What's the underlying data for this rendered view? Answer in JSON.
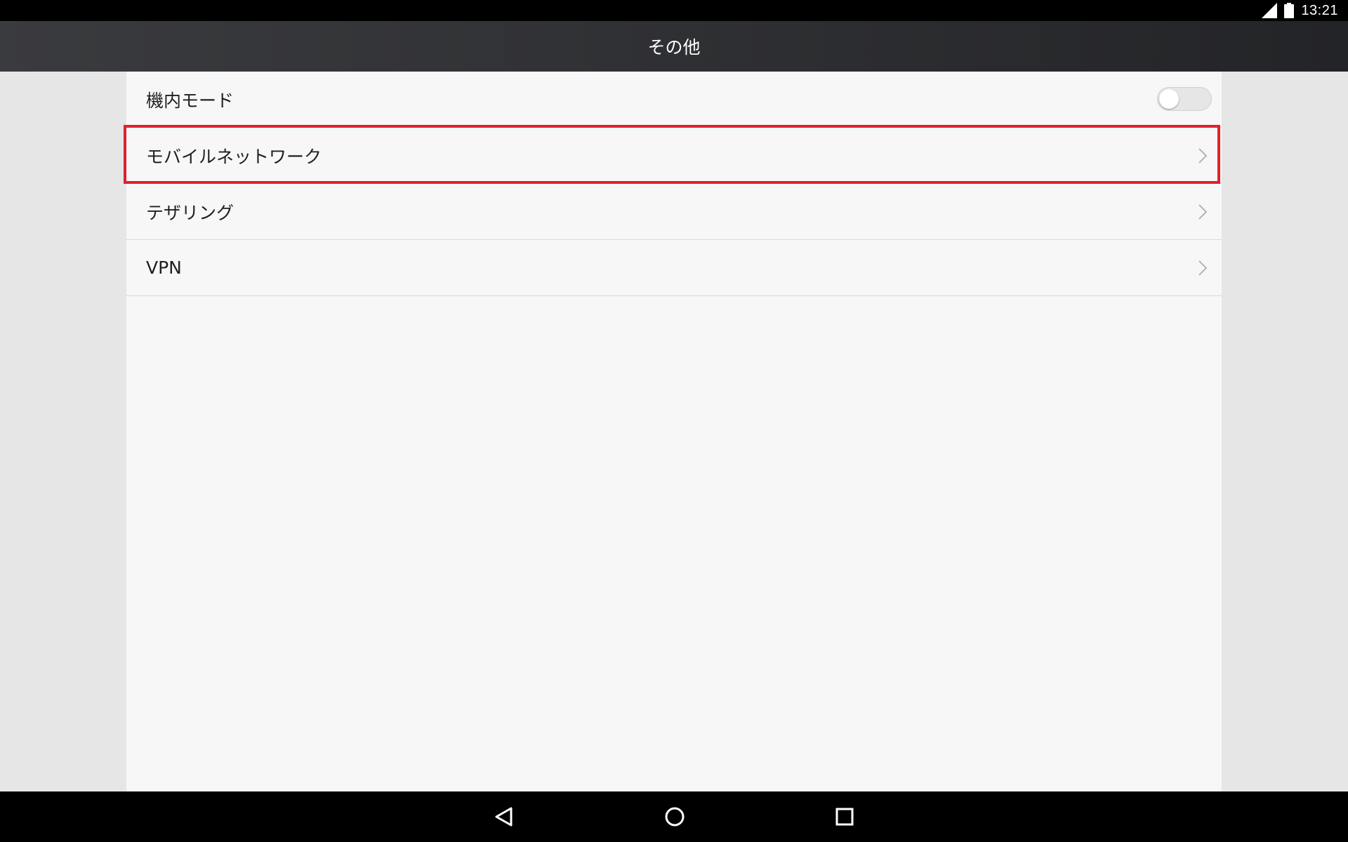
{
  "status_bar": {
    "time": "13:21",
    "icons": [
      "signal-icon",
      "battery-icon"
    ]
  },
  "header": {
    "title": "その他"
  },
  "settings": {
    "items": [
      {
        "label": "機内モード",
        "control": "toggle",
        "toggle_on": false
      },
      {
        "label": "モバイルネットワーク",
        "control": "chevron",
        "highlighted": true
      },
      {
        "label": "テザリング",
        "control": "chevron"
      },
      {
        "label": "VPN",
        "control": "chevron"
      }
    ]
  },
  "nav_bar": {
    "buttons": [
      "back-icon",
      "home-icon",
      "recents-icon"
    ]
  },
  "colors": {
    "highlight": "#e0202e",
    "title_bar": "#2f3033",
    "content_bg": "#f7f7f7"
  }
}
